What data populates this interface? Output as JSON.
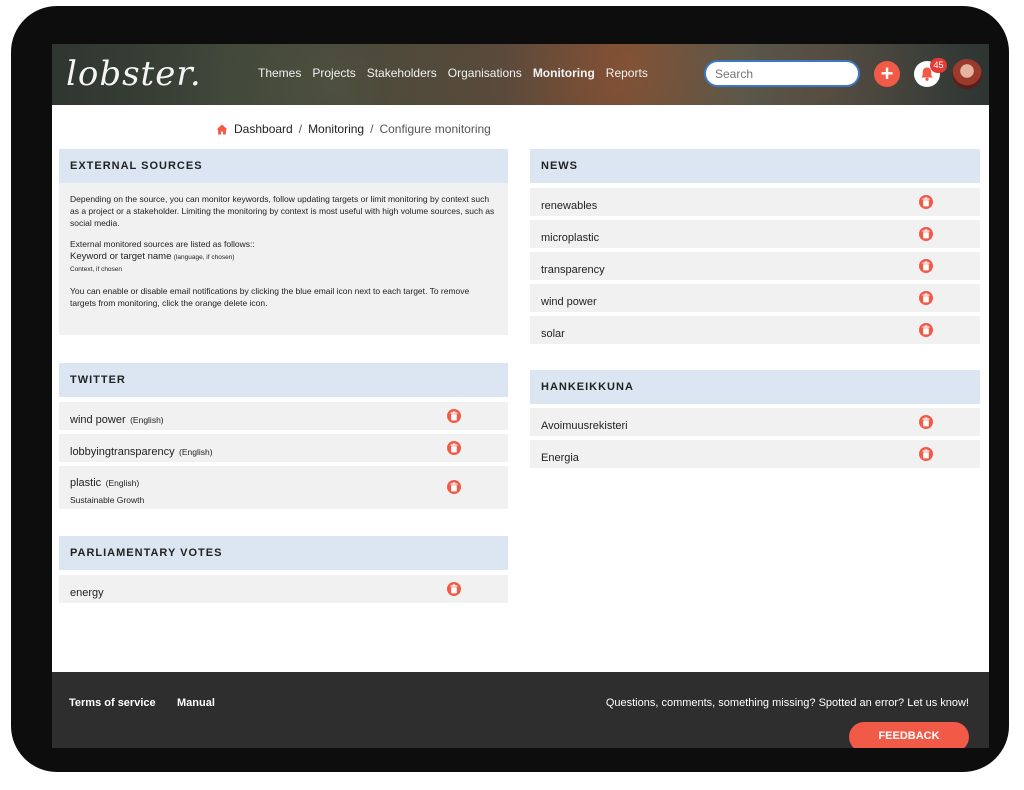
{
  "header": {
    "logo": "lobster.",
    "nav": [
      "Themes",
      "Projects",
      "Stakeholders",
      "Organisations",
      "Monitoring",
      "Reports"
    ],
    "active_nav": "Monitoring",
    "search_placeholder": "Search",
    "add_label": "+",
    "notification_count": "45"
  },
  "breadcrumb": {
    "home": "Dashboard",
    "section": "Monitoring",
    "current": "Configure monitoring",
    "sep": "/"
  },
  "external_sources": {
    "title": "EXTERNAL SOURCES",
    "p1": "Depending on the source, you can monitor keywords, follow updating targets or limit monitoring by context such as a project or a stakeholder. Limiting the monitoring by context is most useful with high volume sources, such as social media.",
    "p2_intro": "External monitored sources are listed as follows::",
    "p2_keyword": "Keyword or target name",
    "p2_lang": "(language, if chosen)",
    "p2_context": "Context, if chosen",
    "p3": "You can enable or disable email notifications by clicking the blue email icon next to each target. To remove targets from monitoring, click the orange delete icon."
  },
  "twitter": {
    "title": "TWITTER",
    "items": [
      {
        "label": "wind power",
        "lang": "(English)",
        "context": ""
      },
      {
        "label": "lobbyingtransparency",
        "lang": "(English)",
        "context": ""
      },
      {
        "label": "plastic",
        "lang": "(English)",
        "context": "Sustainable Growth"
      }
    ]
  },
  "parliamentary": {
    "title": "PARLIAMENTARY VOTES",
    "items": [
      {
        "label": "energy"
      }
    ]
  },
  "news": {
    "title": "NEWS",
    "items": [
      {
        "label": "renewables"
      },
      {
        "label": "microplastic"
      },
      {
        "label": "transparency"
      },
      {
        "label": "wind power"
      },
      {
        "label": "solar"
      }
    ]
  },
  "hankeikkuna": {
    "title": "HANKEIKKUNA",
    "items": [
      {
        "label": "Avoimuusrekisteri"
      },
      {
        "label": "Energia"
      }
    ]
  },
  "footer": {
    "terms": "Terms of service",
    "manual": "Manual",
    "message": "Questions, comments, something missing? Spotted an error? Let us know!",
    "feedback": "FEEDBACK"
  },
  "colors": {
    "accent": "#f15a47",
    "panel_header": "#dbe6f2",
    "row_bg": "#f1f1f1",
    "footer_bg": "#2e2e2e"
  },
  "icons": {
    "home": "home-icon",
    "delete": "trash-icon",
    "bell": "bell-icon",
    "add": "plus-icon"
  }
}
